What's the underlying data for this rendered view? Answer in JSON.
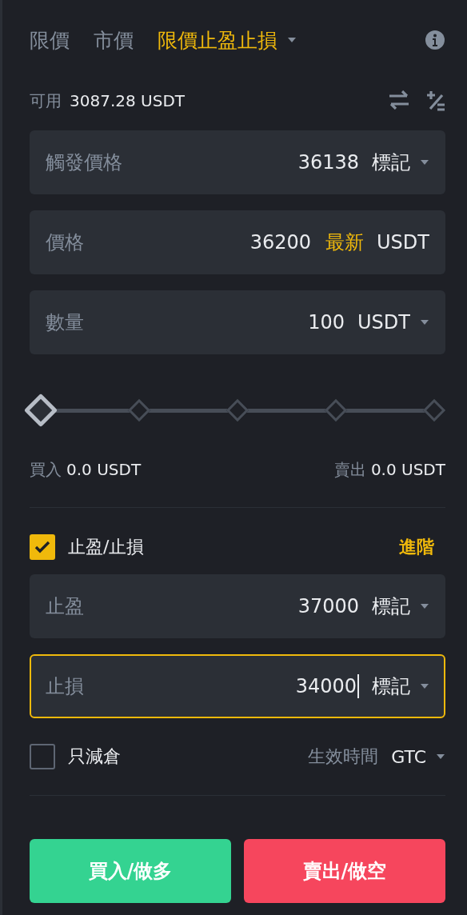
{
  "order_tabs": [
    {
      "label": "限價",
      "selected": false,
      "dropdown": false
    },
    {
      "label": "市價",
      "selected": false,
      "dropdown": false
    },
    {
      "label": "限價止盈止損",
      "selected": true,
      "dropdown": true
    }
  ],
  "available": {
    "label": "可用",
    "value": "3087.28 USDT"
  },
  "fields": [
    {
      "label": "觸發價格",
      "value": "36138",
      "suffix": "標記",
      "dropdown": true,
      "focused": false
    },
    {
      "label": "價格",
      "value": "36200",
      "tag": "最新",
      "suffix": "USDT",
      "dropdown": false,
      "focused": false
    },
    {
      "label": "數量",
      "value": "100",
      "suffix": "USDT",
      "dropdown": true,
      "focused": false
    }
  ],
  "slider": {
    "level": 0
  },
  "totals": [
    {
      "label": "買入",
      "value": "0.0 USDT"
    },
    {
      "label": "賣出",
      "value": "0.0 USDT"
    }
  ],
  "tp_sl": {
    "label": "止盈/止損",
    "checked": true,
    "advanced": "進階",
    "fields": [
      {
        "label": "止盈",
        "value": "37000",
        "suffix": "標記",
        "dropdown": true,
        "focused": false
      },
      {
        "label": "止損",
        "value": "34000",
        "suffix": "標記",
        "dropdown": true,
        "focused": true
      }
    ]
  },
  "reduce_only": {
    "label": "只減倉",
    "checked": false
  },
  "time_in_force": {
    "label": "生效時間",
    "value": "GTC",
    "dropdown": true
  },
  "buttons": [
    {
      "label": "買入/做多",
      "kind": "buy"
    },
    {
      "label": "賣出/做空",
      "kind": "sell"
    }
  ]
}
